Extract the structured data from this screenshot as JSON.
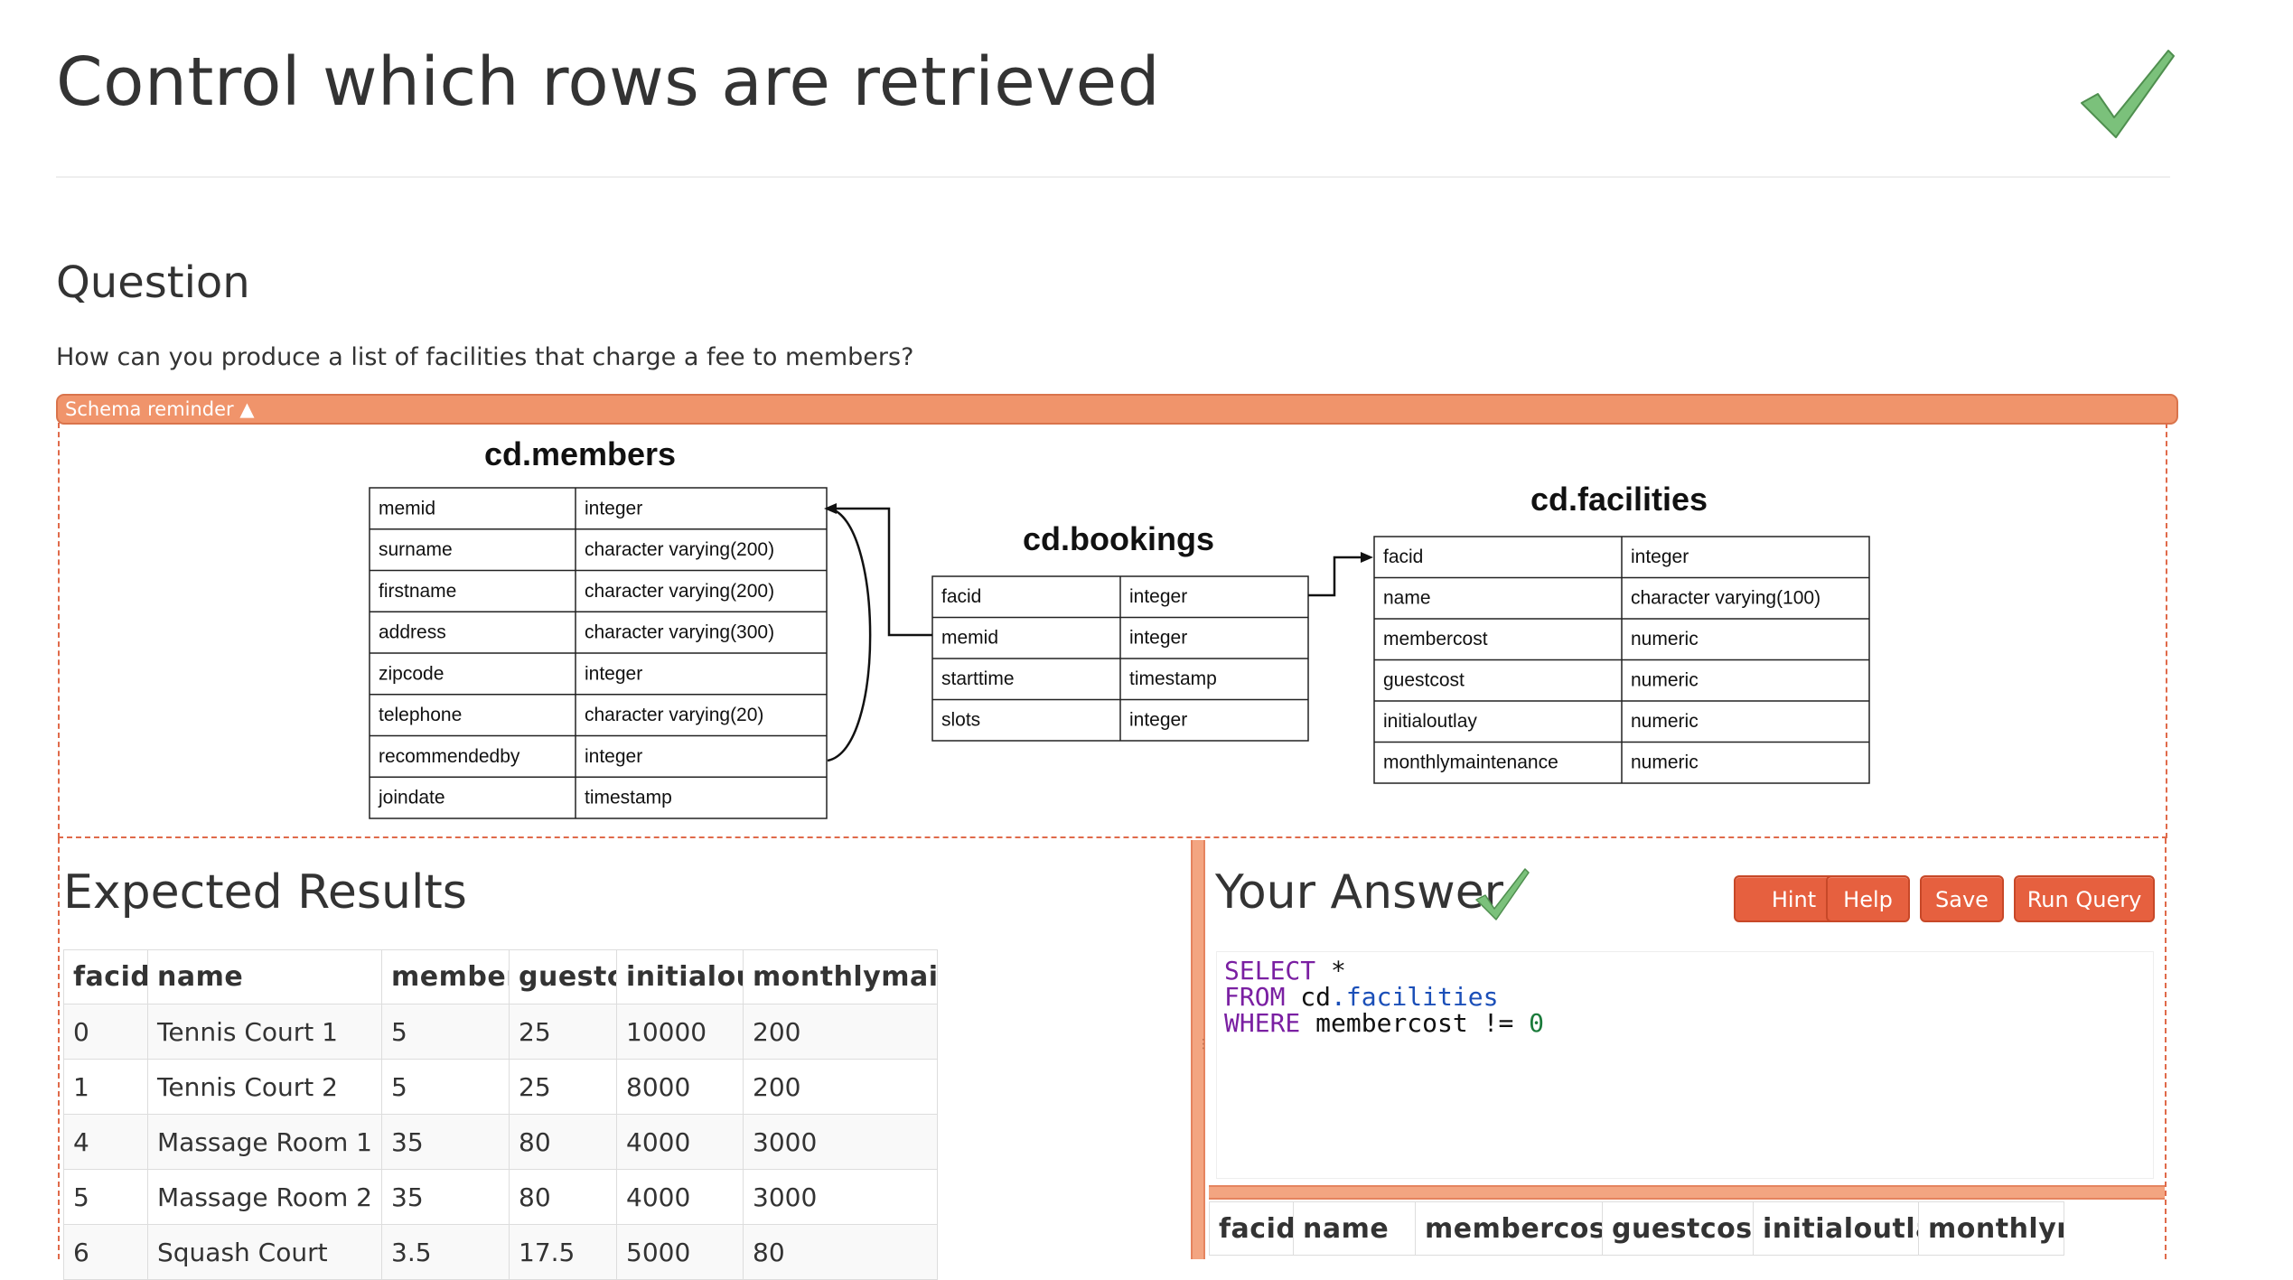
{
  "page": {
    "title": "Control which rows are retrieved",
    "question_heading": "Question",
    "question_text": "How can you produce a list of facilities that charge a fee to members?"
  },
  "schema": {
    "toggle_label": "Schema reminder ▲",
    "tables": [
      {
        "name": "cd.members",
        "rows": [
          [
            "memid",
            "integer"
          ],
          [
            "surname",
            "character varying(200)"
          ],
          [
            "firstname",
            "character varying(200)"
          ],
          [
            "address",
            "character varying(300)"
          ],
          [
            "zipcode",
            "integer"
          ],
          [
            "telephone",
            "character varying(20)"
          ],
          [
            "recommendedby",
            "integer"
          ],
          [
            "joindate",
            "timestamp"
          ]
        ]
      },
      {
        "name": "cd.bookings",
        "rows": [
          [
            "facid",
            "integer"
          ],
          [
            "memid",
            "integer"
          ],
          [
            "starttime",
            "timestamp"
          ],
          [
            "slots",
            "integer"
          ]
        ]
      },
      {
        "name": "cd.facilities",
        "rows": [
          [
            "facid",
            "integer"
          ],
          [
            "name",
            "character varying(100)"
          ],
          [
            "membercost",
            "numeric"
          ],
          [
            "guestcost",
            "numeric"
          ],
          [
            "initialoutlay",
            "numeric"
          ],
          [
            "monthlymaintenance",
            "numeric"
          ]
        ]
      }
    ]
  },
  "expected": {
    "heading": "Expected Results",
    "columns": [
      "facid",
      "name",
      "membercost",
      "guestcost",
      "initialoutlay",
      "monthlymaintenance"
    ],
    "rows": [
      [
        "0",
        "Tennis Court 1",
        "5",
        "25",
        "10000",
        "200"
      ],
      [
        "1",
        "Tennis Court 2",
        "5",
        "25",
        "8000",
        "200"
      ],
      [
        "4",
        "Massage Room 1",
        "35",
        "80",
        "4000",
        "3000"
      ],
      [
        "5",
        "Massage Room 2",
        "35",
        "80",
        "4000",
        "3000"
      ],
      [
        "6",
        "Squash Court",
        "3.5",
        "17.5",
        "5000",
        "80"
      ]
    ]
  },
  "answer": {
    "heading": "Your Answer",
    "buttons": {
      "hint": "Hint",
      "help": "Help",
      "save": "Save",
      "run": "Run Query"
    },
    "query_tokens": {
      "select": "SELECT",
      "star": "*",
      "from": "FROM",
      "schema": "cd",
      "dot": ".",
      "table": "facilities",
      "where": "WHERE",
      "column": "membercost",
      "op": "!=",
      "value": "0"
    },
    "result_columns": [
      "facid",
      "name",
      "membercost",
      "guestcost",
      "initialoutlay",
      "monthlymaintena"
    ]
  },
  "colors": {
    "accent": "#f0946b",
    "button": "#e6603f",
    "check": "#6bb56b",
    "sql_keyword": "#7a1fa2",
    "sql_table": "#1b4fb8",
    "sql_number": "#1a7a3a"
  },
  "icons": [
    "checkmark-icon",
    "triangle-up-icon"
  ]
}
